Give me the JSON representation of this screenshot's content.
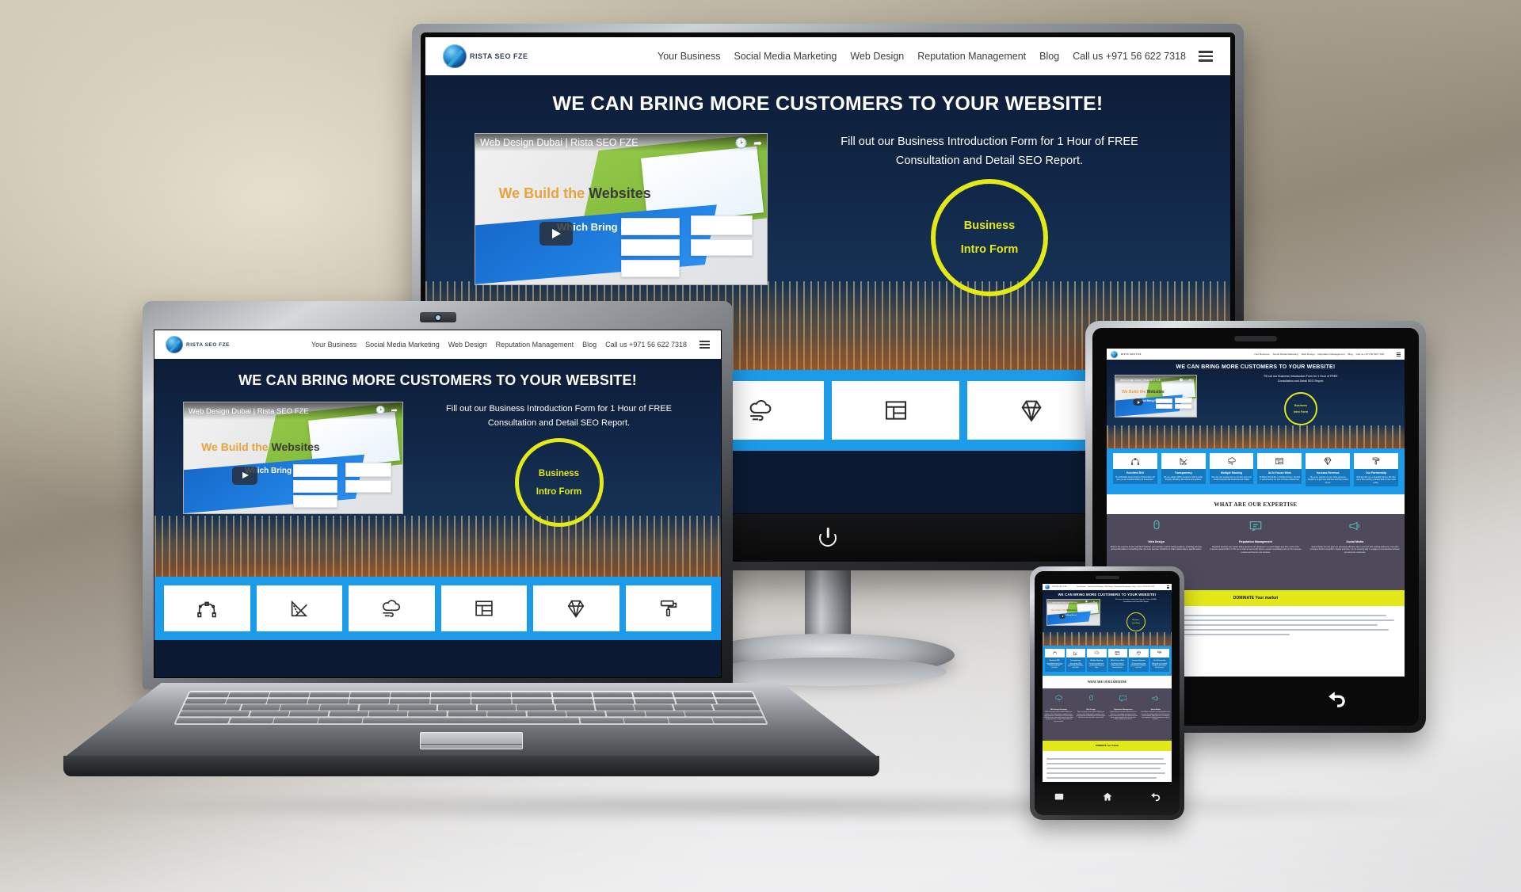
{
  "brand": {
    "name": "RISTA SEO FZE",
    "logo_icon": "globe-swoosh-icon"
  },
  "nav": {
    "items": [
      "Your Business",
      "Social Media Marketing",
      "Web Design",
      "Reputation Management",
      "Blog",
      "Call us +971 56 622 7318"
    ],
    "menu_icon": "hamburger-menu-icon"
  },
  "hero": {
    "title": "WE CAN BRING MORE CUSTOMERS TO YOUR WEBSITE!",
    "copy_line1": "Fill out our Business Introduction Form for 1 Hour of FREE",
    "copy_line2": "Consultation and Detail SEO Report.",
    "cta_line1": "Business",
    "cta_line2": "Intro Form",
    "cta_color": "#e3e819"
  },
  "video": {
    "title": "Web Design Dubai | Rista SEO FZE",
    "headline_accent": "We Build the",
    "headline_main": "Websites",
    "subline": "Which Bring Result",
    "play_icon": "play-icon",
    "watch_later_icon": "clock-icon",
    "share_icon": "share-icon"
  },
  "icon_band": {
    "accent": "#1b9bea",
    "icons": [
      "pen-tool-icon",
      "ruler-triangle-icon",
      "cloud-wind-icon",
      "layout-grid-icon",
      "diamond-icon",
      "paint-roller-icon"
    ]
  },
  "features": [
    {
      "icon": "pen-tool-icon",
      "title": "Excellent ROI",
      "body": "Our affordable Search Engine Optimization will give you an excellent Return for Investment."
    },
    {
      "icon": "ruler-triangle-icon",
      "title": "Transparency",
      "body": "We are always 100% transparent with monthly Reports, Ranking, Site Issues and updates."
    },
    {
      "icon": "cloud-wind-icon",
      "title": "Multiple Ranking",
      "body": "Not only your website but we can also rank your social properties like Facebook and Twitter."
    },
    {
      "icon": "layout-grid-icon",
      "title": "All In House Work",
      "body": "No Black Hat Tactics or Cutting Corners. All work is performed by our own in house professional."
    },
    {
      "icon": "diamond-icon",
      "title": "Increase Revenue",
      "body": "The entire purpose of your online presence should be to get more business and that is what we do."
    },
    {
      "icon": "paint-roller-icon",
      "title": "Our Partnership",
      "body": "Working with us is a beautiful journey. We offer worry free monthly contracts with an open door policy."
    }
  ],
  "expertise": {
    "heading": "WHAT ARE OUR EXPERTISE",
    "columns": [
      {
        "icon": "cloud-seo-icon",
        "title": "Web Design Dominate",
        "body": "What is the purpose of your website? Whether your website is about selling products, providing services, giving information or something else, the main purpose should be to make visitors take a specific action so that you get more leads, customers, clients which will generate revenue."
      },
      {
        "icon": "mouse-icon",
        "title": "Web Design",
        "body": "What is the purpose of your website? Whether your website is about selling products, providing services, giving information or something else, the main purpose should be to make visitors take a specific action."
      },
      {
        "icon": "chat-screen-icon",
        "title": "Reputation Management",
        "body": "Negative Reviews can impact online presence of a business in a much bigger way than most of the business owners think. In this era of Internet and smart phone, people immediately look up the business reviews and then try our services."
      },
      {
        "icon": "megaphone-icon",
        "title": "Social Media",
        "body": "Social Media not only gives an extremely effective way to connect with existing audience, but it also increases brand recognition, loyalty and trust. It is an amazing way to engage in conversation between you and your customers."
      }
    ]
  },
  "dominate_banner": {
    "text": "DOMINATE Your market"
  },
  "devices": {
    "monitor": {
      "name": "desktop-monitor",
      "power_icon": "power-icon"
    },
    "laptop": {
      "name": "laptop",
      "camera_icon": "webcam-icon"
    },
    "tablet": {
      "name": "tablet",
      "buttons": [
        "home-icon",
        "back-icon"
      ]
    },
    "phone": {
      "name": "smartphone",
      "buttons": [
        "recents-icon",
        "home-icon",
        "back-icon"
      ]
    }
  }
}
